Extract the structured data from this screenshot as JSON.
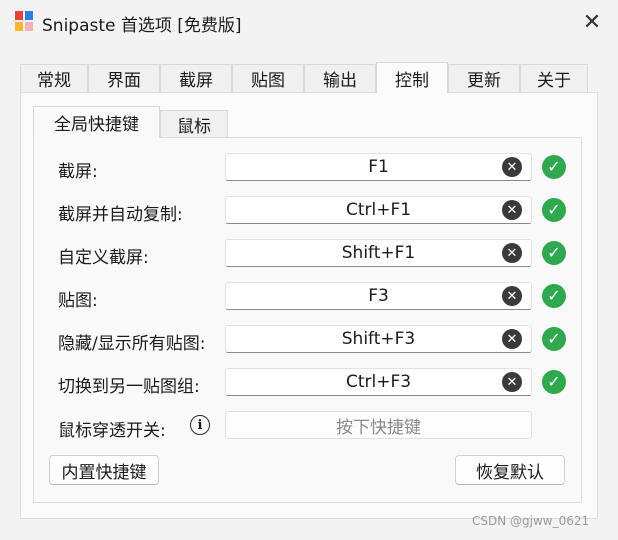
{
  "window": {
    "title": "Snipaste 首选项 [免费版]",
    "close_glyph": "✕"
  },
  "tabs": [
    {
      "label": "常规"
    },
    {
      "label": "界面"
    },
    {
      "label": "截屏"
    },
    {
      "label": "贴图"
    },
    {
      "label": "输出"
    },
    {
      "label": "控制",
      "active": true
    },
    {
      "label": "更新"
    },
    {
      "label": "关于"
    }
  ],
  "subtabs": [
    {
      "label": "全局快捷键",
      "active": true
    },
    {
      "label": "鼠标"
    }
  ],
  "shortcuts": [
    {
      "label": "截屏:",
      "value": "F1",
      "status": "ok"
    },
    {
      "label": "截屏并自动复制:",
      "value": "Ctrl+F1",
      "status": "ok"
    },
    {
      "label": "自定义截屏:",
      "value": "Shift+F1",
      "status": "ok"
    },
    {
      "label": "贴图:",
      "value": "F3",
      "status": "ok"
    },
    {
      "label": "隐藏/显示所有贴图:",
      "value": "Shift+F3",
      "status": "ok"
    },
    {
      "label": "切换到另一贴图组:",
      "value": "Ctrl+F3",
      "status": "ok"
    }
  ],
  "mouse_passthrough": {
    "label": "鼠标穿透开关:",
    "placeholder": "按下快捷键",
    "info_glyph": "i"
  },
  "buttons": {
    "builtin_label": "内置快捷键",
    "restore_label": "恢复默认"
  },
  "icons": {
    "clear": "clear-circle-icon",
    "ok": "check-circle-icon",
    "clear_glyph": "✕",
    "ok_glyph": "✓"
  },
  "colors": {
    "ok_green": "#2fa84f",
    "clear_dark": "#3a3a3a",
    "logo_red": "#e8433a",
    "logo_blue": "#2f7de1",
    "logo_yellow": "#f5b82e"
  },
  "watermark": "CSDN @gjww_0621"
}
